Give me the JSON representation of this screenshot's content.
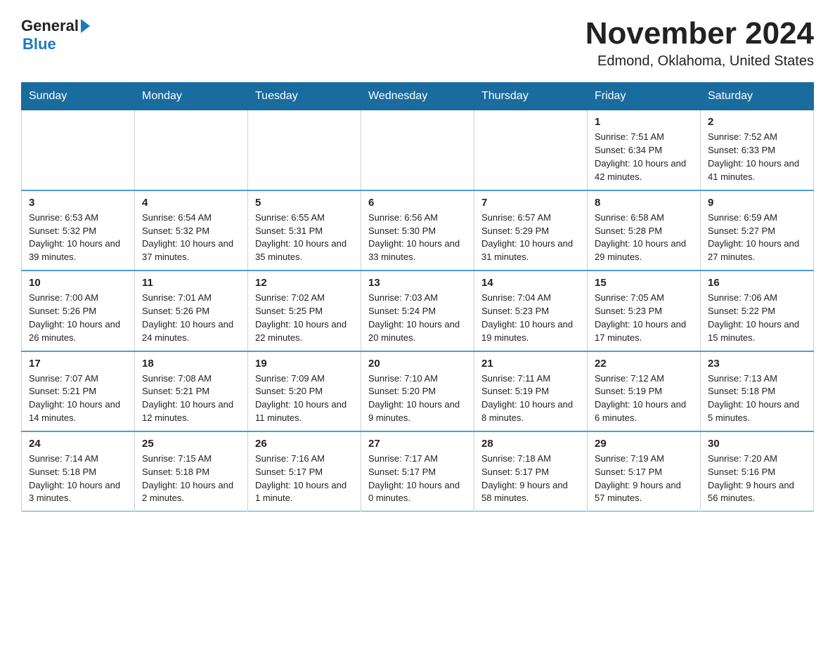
{
  "logo": {
    "text_general": "General",
    "text_blue": "Blue"
  },
  "title": "November 2024",
  "subtitle": "Edmond, Oklahoma, United States",
  "days_of_week": [
    "Sunday",
    "Monday",
    "Tuesday",
    "Wednesday",
    "Thursday",
    "Friday",
    "Saturday"
  ],
  "weeks": [
    [
      {
        "day": "",
        "info": ""
      },
      {
        "day": "",
        "info": ""
      },
      {
        "day": "",
        "info": ""
      },
      {
        "day": "",
        "info": ""
      },
      {
        "day": "",
        "info": ""
      },
      {
        "day": "1",
        "info": "Sunrise: 7:51 AM\nSunset: 6:34 PM\nDaylight: 10 hours and 42 minutes."
      },
      {
        "day": "2",
        "info": "Sunrise: 7:52 AM\nSunset: 6:33 PM\nDaylight: 10 hours and 41 minutes."
      }
    ],
    [
      {
        "day": "3",
        "info": "Sunrise: 6:53 AM\nSunset: 5:32 PM\nDaylight: 10 hours and 39 minutes."
      },
      {
        "day": "4",
        "info": "Sunrise: 6:54 AM\nSunset: 5:32 PM\nDaylight: 10 hours and 37 minutes."
      },
      {
        "day": "5",
        "info": "Sunrise: 6:55 AM\nSunset: 5:31 PM\nDaylight: 10 hours and 35 minutes."
      },
      {
        "day": "6",
        "info": "Sunrise: 6:56 AM\nSunset: 5:30 PM\nDaylight: 10 hours and 33 minutes."
      },
      {
        "day": "7",
        "info": "Sunrise: 6:57 AM\nSunset: 5:29 PM\nDaylight: 10 hours and 31 minutes."
      },
      {
        "day": "8",
        "info": "Sunrise: 6:58 AM\nSunset: 5:28 PM\nDaylight: 10 hours and 29 minutes."
      },
      {
        "day": "9",
        "info": "Sunrise: 6:59 AM\nSunset: 5:27 PM\nDaylight: 10 hours and 27 minutes."
      }
    ],
    [
      {
        "day": "10",
        "info": "Sunrise: 7:00 AM\nSunset: 5:26 PM\nDaylight: 10 hours and 26 minutes."
      },
      {
        "day": "11",
        "info": "Sunrise: 7:01 AM\nSunset: 5:26 PM\nDaylight: 10 hours and 24 minutes."
      },
      {
        "day": "12",
        "info": "Sunrise: 7:02 AM\nSunset: 5:25 PM\nDaylight: 10 hours and 22 minutes."
      },
      {
        "day": "13",
        "info": "Sunrise: 7:03 AM\nSunset: 5:24 PM\nDaylight: 10 hours and 20 minutes."
      },
      {
        "day": "14",
        "info": "Sunrise: 7:04 AM\nSunset: 5:23 PM\nDaylight: 10 hours and 19 minutes."
      },
      {
        "day": "15",
        "info": "Sunrise: 7:05 AM\nSunset: 5:23 PM\nDaylight: 10 hours and 17 minutes."
      },
      {
        "day": "16",
        "info": "Sunrise: 7:06 AM\nSunset: 5:22 PM\nDaylight: 10 hours and 15 minutes."
      }
    ],
    [
      {
        "day": "17",
        "info": "Sunrise: 7:07 AM\nSunset: 5:21 PM\nDaylight: 10 hours and 14 minutes."
      },
      {
        "day": "18",
        "info": "Sunrise: 7:08 AM\nSunset: 5:21 PM\nDaylight: 10 hours and 12 minutes."
      },
      {
        "day": "19",
        "info": "Sunrise: 7:09 AM\nSunset: 5:20 PM\nDaylight: 10 hours and 11 minutes."
      },
      {
        "day": "20",
        "info": "Sunrise: 7:10 AM\nSunset: 5:20 PM\nDaylight: 10 hours and 9 minutes."
      },
      {
        "day": "21",
        "info": "Sunrise: 7:11 AM\nSunset: 5:19 PM\nDaylight: 10 hours and 8 minutes."
      },
      {
        "day": "22",
        "info": "Sunrise: 7:12 AM\nSunset: 5:19 PM\nDaylight: 10 hours and 6 minutes."
      },
      {
        "day": "23",
        "info": "Sunrise: 7:13 AM\nSunset: 5:18 PM\nDaylight: 10 hours and 5 minutes."
      }
    ],
    [
      {
        "day": "24",
        "info": "Sunrise: 7:14 AM\nSunset: 5:18 PM\nDaylight: 10 hours and 3 minutes."
      },
      {
        "day": "25",
        "info": "Sunrise: 7:15 AM\nSunset: 5:18 PM\nDaylight: 10 hours and 2 minutes."
      },
      {
        "day": "26",
        "info": "Sunrise: 7:16 AM\nSunset: 5:17 PM\nDaylight: 10 hours and 1 minute."
      },
      {
        "day": "27",
        "info": "Sunrise: 7:17 AM\nSunset: 5:17 PM\nDaylight: 10 hours and 0 minutes."
      },
      {
        "day": "28",
        "info": "Sunrise: 7:18 AM\nSunset: 5:17 PM\nDaylight: 9 hours and 58 minutes."
      },
      {
        "day": "29",
        "info": "Sunrise: 7:19 AM\nSunset: 5:17 PM\nDaylight: 9 hours and 57 minutes."
      },
      {
        "day": "30",
        "info": "Sunrise: 7:20 AM\nSunset: 5:16 PM\nDaylight: 9 hours and 56 minutes."
      }
    ]
  ]
}
